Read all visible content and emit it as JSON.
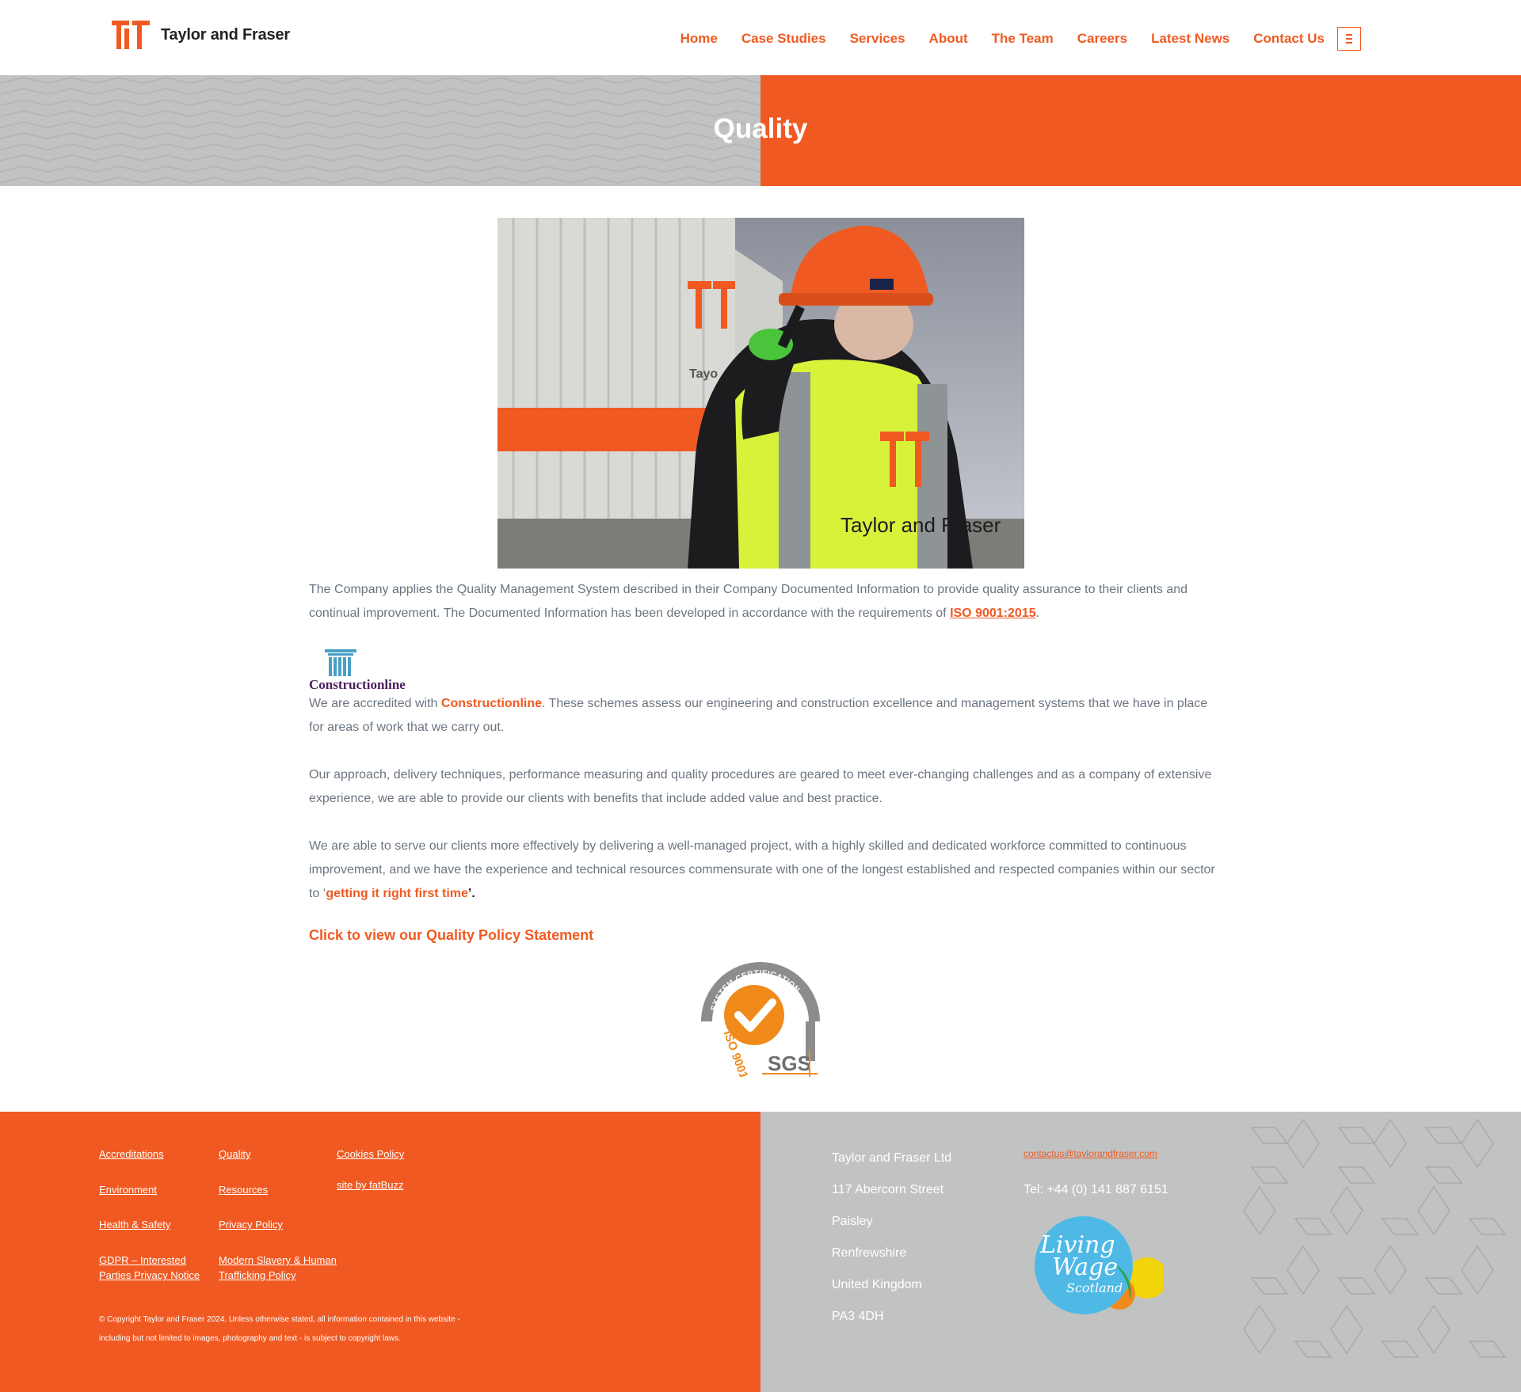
{
  "header": {
    "brand": "Taylor and Fraser",
    "nav": [
      "Home",
      "Case Studies",
      "Services",
      "About",
      "The Team",
      "Careers",
      "Latest News",
      "Contact Us"
    ]
  },
  "banner": {
    "title": "Quality"
  },
  "hero": {
    "vest_text": "Taylor and Fraser",
    "container_text": "Tayo"
  },
  "content": {
    "para1_a": "The Company applies the Quality Management System described in their Company Documented Information to provide quality assurance to their clients and continual improvement.  The Documented Information has been developed in accordance with the requirements of ",
    "iso_link": "ISO 9001:2015",
    "para1_end": ".",
    "constructionline_logo": "Constructionline",
    "para2_a": "We are accredited with ",
    "para2_link": "Constructionline",
    "para2_b": ". These schemes assess our engineering and construction excellence and management systems that we have in place for areas of work that we carry out.",
    "para3": "Our approach, delivery techniques, performance measuring and quality procedures are geared to meet ever-changing challenges and as a company of extensive experience, we are able to provide our clients with benefits that include added value and best practice.",
    "para4_a": "We are able to serve our clients more effectively by delivering a well-managed project, with a highly skilled and dedicated workforce committed to continuous improvement, and we have the experience and technical resources commensurate with one of the longest established and respected companies within our sector to ‘",
    "para4_highlight": "getting it right first time",
    "para4_end": "’.",
    "policy_link": "Click to view our Quality Policy Statement",
    "sgs": {
      "arc_text": "SYSTEM CERTIFICATION",
      "iso": "ISO 9001",
      "brand": "SGS"
    }
  },
  "footer": {
    "links_col1": [
      "Accreditations",
      "Environment",
      "Health & Safety",
      "GDPR – Interested",
      "Parties Privacy Notice"
    ],
    "links_col2": [
      "Quality",
      "Resources",
      "Privacy Policy",
      "Modern Slavery & Human",
      "Trafficking Policy"
    ],
    "links_col3": [
      "Cookies Policy",
      "site by fatBuzz"
    ],
    "copyright_1": "© Copyright Taylor and Fraser 2024. Unless otherwise stated, all information contained in this website -",
    "copyright_2": "including but not limited to images, photography and text - is subject to copyright laws.",
    "address": [
      "Taylor and Fraser Ltd",
      "117 Abercorn Street",
      "Paisley",
      "Renfrewshire",
      "United Kingdom",
      "PA3 4DH"
    ],
    "email": "contactus@taylorandfraser.com",
    "tel": "Tel: +44 (0) 141 887 6151",
    "living_wage": {
      "line1": "Living",
      "line2": "Wage",
      "line3": "Scotland"
    }
  },
  "colors": {
    "brand_orange": "#f05a22",
    "grey": "#c1c3c3",
    "text_grey": "#6b7580"
  }
}
